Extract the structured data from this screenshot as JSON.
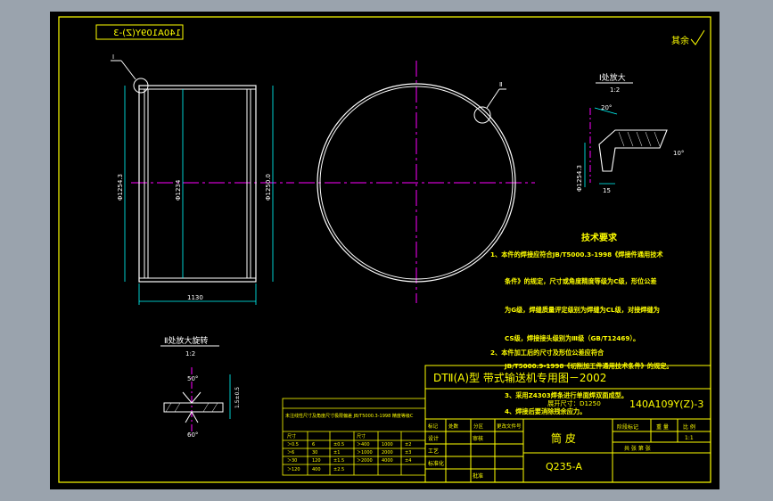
{
  "drawing_no": "140A109Y(Z)-3",
  "drawing_no_mirrored": "140A109Y(Z)-3",
  "title_block": {
    "header": "DTⅡ(A)型 带式输送机专用图－2002",
    "part_name": "筒 皮",
    "material": "Q235-A",
    "stage_mark": "阶段标记",
    "weight_label": "重 量",
    "scale_label": "比 例",
    "scale_value": "1:1",
    "sheet_label": "共 张  第 张",
    "sign_labels": [
      "标记",
      "处数",
      "分区",
      "更改文件号",
      "签名",
      "年月日"
    ],
    "role_labels": [
      "设计",
      "审核",
      "工艺",
      "标准化",
      "批准"
    ]
  },
  "corner_note": "其余",
  "tech_title": "技术要求",
  "tech_lines": [
    "1、本件的焊接应符合JB/T5000.3-1998《焊接件通用技术",
    "条件》的规定，尺寸或角度精度等级为C级，形位公差",
    "为G级，焊缝质量评定级别为焊缝为CL级，对接焊缝为",
    "CS级，焊接接头级别为Ⅲ级（GB/T12469）。",
    "2、本件加工后的尺寸及形位公差应符合",
    "JB/T5000.9-1998《切削加工件通用技术条件》的规定。",
    "3、采用Z4303焊条进行单面焊双面成型。",
    "4、焊接后要消除残余应力。"
  ],
  "tech_extra": "展开尺寸：D1250",
  "detail_i": {
    "title": "Ⅰ处放大",
    "scale": "1:2",
    "angle": "20°",
    "angle2": "10°",
    "dia": "Φ1254.3",
    "width": "15"
  },
  "detail_ii": {
    "title": "Ⅱ处放大旋转",
    "scale": "1:2",
    "angle_top": "50°",
    "angle_bottom": "60°",
    "note": "1.5±0.5"
  },
  "callouts": {
    "left": "Ⅰ",
    "right": "Ⅱ"
  },
  "dims": {
    "outer": "Φ1250.0",
    "inner": "Φ1234",
    "bore": "Φ1254.3",
    "length": "1130"
  },
  "tolerance_table": {
    "title": "未注线性尺寸及角度尺寸极限偏差 JB/T5000.3-1998 精度等级C",
    "rows": [
      [
        "尺寸",
        "",
        "",
        "尺寸",
        "",
        ""
      ],
      [
        "＞0.5",
        "6",
        "±0.5",
        "＞400",
        "1000",
        "±2"
      ],
      [
        "＞6",
        "30",
        "±1",
        "＞1000",
        "2000",
        "±3"
      ],
      [
        "＞30",
        "120",
        "±1.5",
        "＞2000",
        "4000",
        "±4"
      ],
      [
        "＞120",
        "400",
        "±2.5",
        "",
        "",
        ""
      ]
    ]
  },
  "colors": {
    "background": "#000000",
    "border": "#ffff00",
    "geometry": "#ffffff",
    "centerline": "#ff00ff",
    "dimension": "#00ffff",
    "text": "#ffff00"
  }
}
